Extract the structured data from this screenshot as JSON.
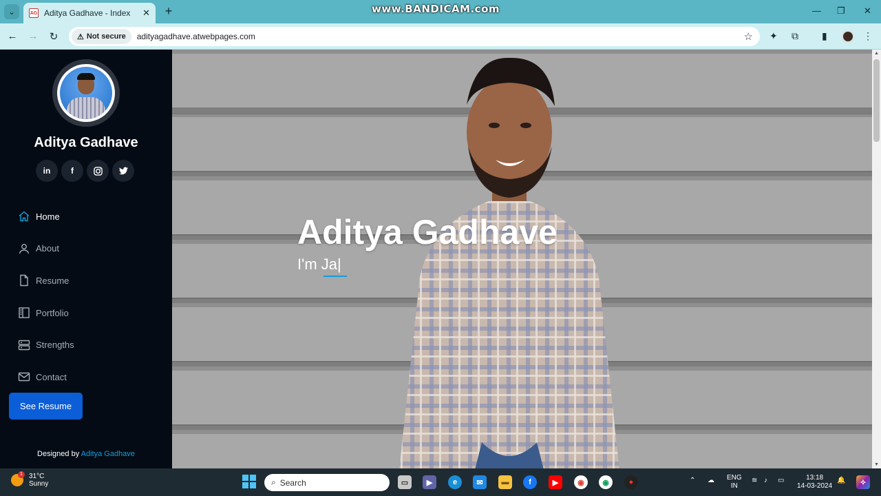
{
  "browser": {
    "tab_title": "Aditya Gadhave - Index",
    "tab_favicon_text": "AG",
    "watermark": "www.BANDICAM.com",
    "security_label": "Not secure",
    "url": "adityagadhave.atwebpages.com"
  },
  "sidebar": {
    "name": "Aditya Gadhave",
    "socials": [
      {
        "icon": "linkedin-icon",
        "glyph": "in"
      },
      {
        "icon": "facebook-icon",
        "glyph": "f"
      },
      {
        "icon": "instagram-icon",
        "glyph": "◎"
      },
      {
        "icon": "twitter-icon",
        "glyph": "🐦"
      }
    ],
    "nav": [
      {
        "label": "Home",
        "icon": "home-icon",
        "active": true
      },
      {
        "label": "About",
        "icon": "person-icon",
        "active": false
      },
      {
        "label": "Resume",
        "icon": "file-icon",
        "active": false
      },
      {
        "label": "Portfolio",
        "icon": "book-icon",
        "active": false
      },
      {
        "label": "Strengths",
        "icon": "server-icon",
        "active": false
      },
      {
        "label": "Contact",
        "icon": "envelope-icon",
        "active": false
      }
    ],
    "cta_label": "See Resume",
    "credit_prefix": "Designed by",
    "credit_link": "Aditya Gadhave"
  },
  "hero": {
    "title": "Aditya Gadhave",
    "subtitle": "I'm Ja|"
  },
  "taskbar": {
    "temperature": "31°C",
    "condition": "Sunny",
    "weather_badge": "1",
    "search_placeholder": "Search",
    "lang_top": "ENG",
    "lang_bottom": "IN",
    "time": "13:18",
    "date": "14-03-2024"
  },
  "colors": {
    "accent": "#149ddd",
    "button": "#0b5ed7",
    "sidebar_bg": "#040b14",
    "tabbar": "#5ab5c4"
  }
}
